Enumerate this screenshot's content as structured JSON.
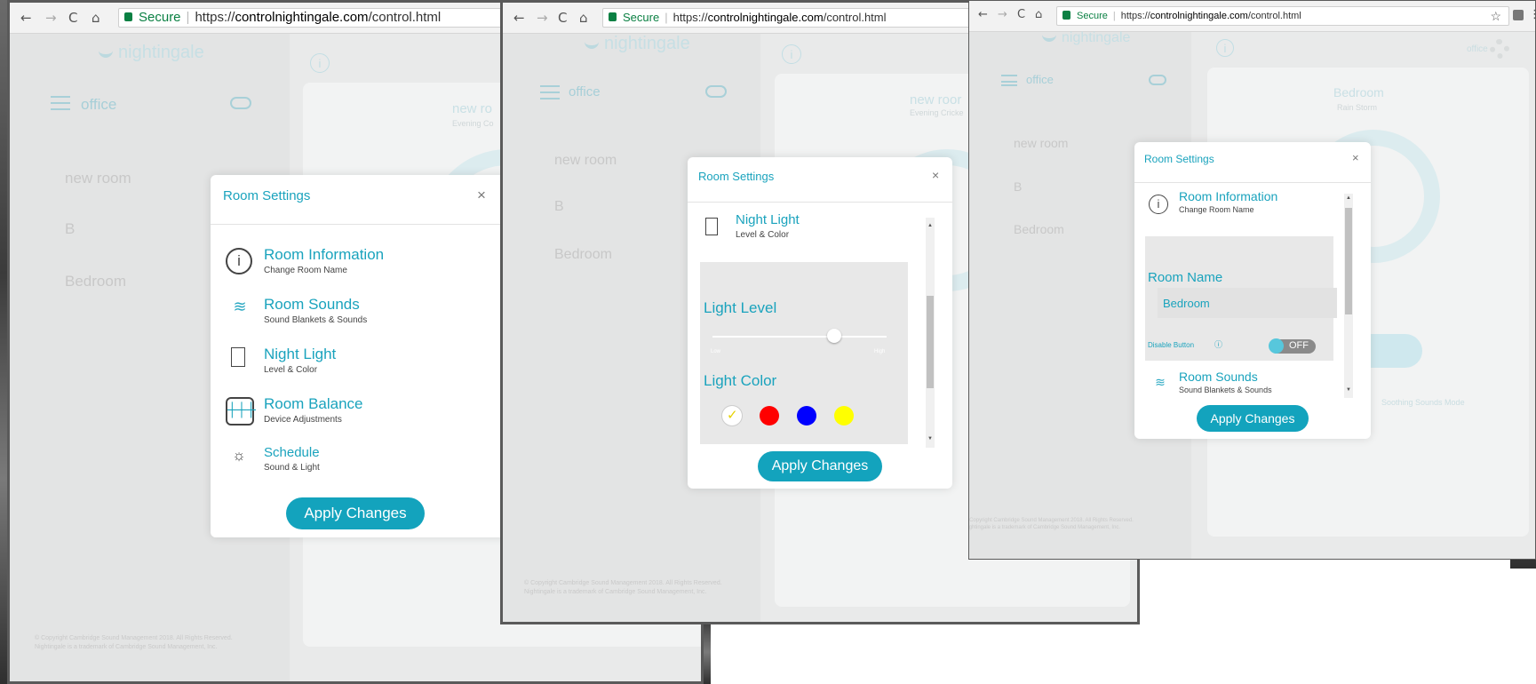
{
  "browser": {
    "secure_label": "Secure",
    "url_prefix": "https://",
    "url_host": "controlnightingale.com",
    "url_path": "/control.html",
    "nav_back": "←",
    "nav_forward": "→",
    "nav_reload": "C",
    "nav_home": "⌂",
    "star": "☆",
    "menu": "⋮"
  },
  "app": {
    "logo_text": "nightingale",
    "site_name": "office",
    "rooms": [
      "new room",
      "B",
      "Bedroom"
    ],
    "footer_line1": "© Copyright Cambridge Sound Management 2018. All Rights Reserved.",
    "footer_line2": "Nightingale is a trademark of Cambridge Sound Management, Inc.",
    "info_glyph": "i"
  },
  "window1": {
    "main_title": "new ro",
    "main_sub": "Evening Co"
  },
  "window2": {
    "main_title": "new roor",
    "main_sub": "Evening Cricke"
  },
  "window3": {
    "main_title": "Bedroom",
    "main_sub": "Rain Storm",
    "site_label": "office",
    "bottom_text": "Soothing Sounds Mode"
  },
  "modal": {
    "title": "Room Settings",
    "close": "×",
    "apply": "Apply Changes",
    "options": [
      {
        "title": "Room Information",
        "subtitle": "Change Room Name",
        "icon": "info-icon"
      },
      {
        "title": "Room Sounds",
        "subtitle": "Sound Blankets & Sounds",
        "icon": "waves-icon"
      },
      {
        "title": "Night Light",
        "subtitle": "Level & Color",
        "icon": "light-icon"
      },
      {
        "title": "Room Balance",
        "subtitle": "Device Adjustments",
        "icon": "sliders-icon"
      },
      {
        "title": "Schedule",
        "subtitle": "Sound & Light",
        "icon": "schedule-icon"
      }
    ]
  },
  "night_light_panel": {
    "light_level_label": "Light Level",
    "low_label": "Low",
    "high_label": "High",
    "light_level": 0.7,
    "light_color_label": "Light Color",
    "colors": [
      "#ffffff",
      "#ff0000",
      "#0000ff",
      "#ffff00"
    ],
    "selected_color": "#ffffff"
  },
  "room_info_panel": {
    "room_name_label": "Room Name",
    "room_name_value": "Bedroom",
    "disable_label": "Disable Button",
    "toggle_text": "OFF"
  }
}
